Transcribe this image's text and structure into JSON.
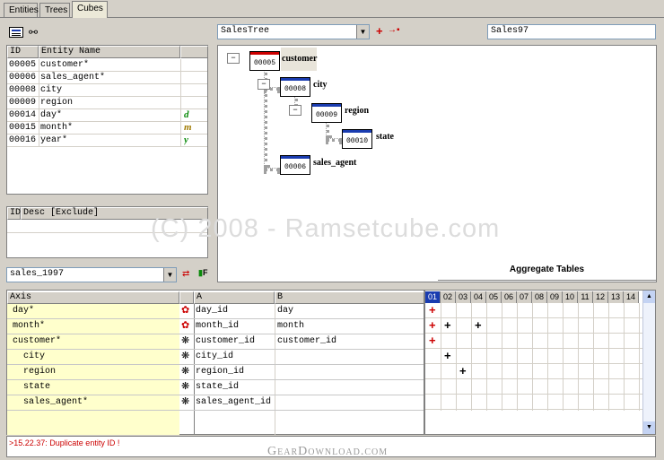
{
  "tabs": [
    "Entities",
    "Trees",
    "Cubes"
  ],
  "active_tab": "Cubes",
  "entity_table": {
    "headers": [
      "ID",
      "Entity Name"
    ],
    "rows": [
      {
        "id": "00005",
        "name": "customer*",
        "icon": ""
      },
      {
        "id": "00006",
        "name": "sales_agent*",
        "icon": ""
      },
      {
        "id": "00008",
        "name": "city",
        "icon": ""
      },
      {
        "id": "00009",
        "name": "region",
        "icon": ""
      },
      {
        "id": "00014",
        "name": "day*",
        "icon": "d"
      },
      {
        "id": "00015",
        "name": "month*",
        "icon": "m"
      },
      {
        "id": "00016",
        "name": "year*",
        "icon": "y"
      }
    ]
  },
  "exclude_table": {
    "headers": [
      "ID",
      "Desc [Exclude]"
    ]
  },
  "cube_select": "sales_1997",
  "tree_select": "SalesTree",
  "cube_name": "Sales97",
  "tree": {
    "nodes": [
      {
        "id": "00005",
        "label": "customer"
      },
      {
        "id": "00008",
        "label": "city"
      },
      {
        "id": "00009",
        "label": "region"
      },
      {
        "id": "00010",
        "label": "state"
      },
      {
        "id": "00006",
        "label": "sales_agent"
      }
    ]
  },
  "watermark": "(C) 2008 - Ramsetcube.com",
  "aggregate_title": "Aggregate Tables",
  "axis_table": {
    "headers": [
      "Axis",
      "A",
      "B"
    ],
    "rows": [
      {
        "axis": "day*",
        "a": "day_id",
        "b": "day"
      },
      {
        "axis": "month*",
        "a": "month_id",
        "b": "month"
      },
      {
        "axis": "customer*",
        "a": "customer_id",
        "b": "customer_id"
      },
      {
        "axis": "city",
        "a": "city_id",
        "b": ""
      },
      {
        "axis": "region",
        "a": "region_id",
        "b": ""
      },
      {
        "axis": "state",
        "a": "state_id",
        "b": ""
      },
      {
        "axis": "sales_agent*",
        "a": "sales_agent_id",
        "b": ""
      }
    ]
  },
  "aggregate_cols": [
    "01",
    "02",
    "03",
    "04",
    "05",
    "06",
    "07",
    "08",
    "09",
    "10",
    "11",
    "12",
    "13",
    "14"
  ],
  "status_message": ">15.22.37: Duplicate entity ID !",
  "footer_brand": "GearDownload.com",
  "colors": {
    "accent_blue": "#1a3cb0",
    "error_red": "#cc0000",
    "axis_yellow": "#ffffcc"
  }
}
